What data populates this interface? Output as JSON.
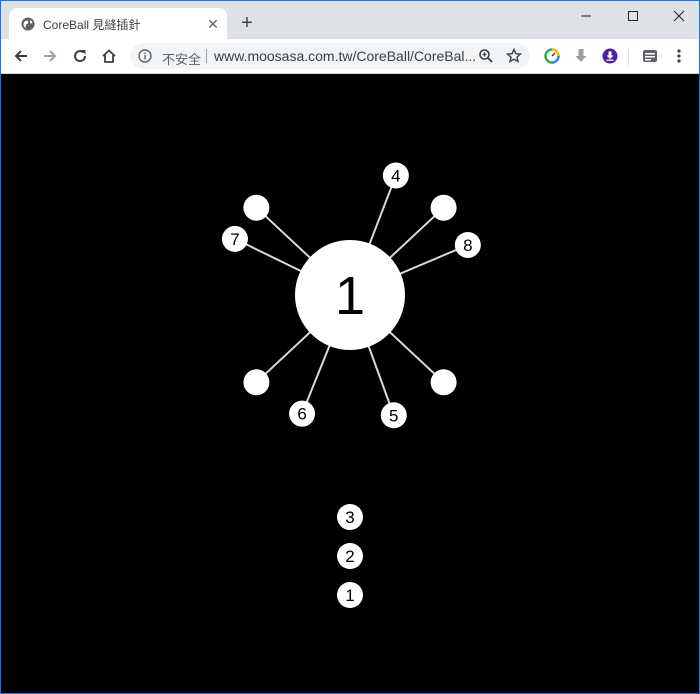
{
  "tab": {
    "title": "CoreBall 見縫插針",
    "close_glyph": "✕",
    "icon": "globe-icon"
  },
  "new_tab_glyph": "+",
  "window_controls": {
    "minimize": "minimize-icon",
    "maximize": "maximize-icon",
    "close": "close-icon"
  },
  "toolbar": {
    "security_label": "不安全",
    "url": "www.moosasa.com.tw/CoreBall/CoreBal...",
    "icons": [
      "back-icon",
      "forward-icon",
      "reload-icon",
      "home-icon",
      "info-icon",
      "zoom-icon",
      "bookmark-star-icon",
      "extension-icon",
      "download-gray-icon",
      "download-purple-icon",
      "extension-icon",
      "menu-icon"
    ]
  },
  "colors": {
    "game_background": "#000000",
    "ball": "#ffffff",
    "needle": "#d9d9d9",
    "number_text": "#000000",
    "accent_purple": "#4a1fa3",
    "accent_blue": "#1a73e8"
  },
  "game": {
    "level": "1",
    "pins": [
      {
        "angle_deg": -69,
        "label": "4"
      },
      {
        "angle_deg": -43,
        "label": ""
      },
      {
        "angle_deg": -23,
        "label": "8"
      },
      {
        "angle_deg": 43,
        "label": ""
      },
      {
        "angle_deg": 70,
        "label": "5"
      },
      {
        "angle_deg": 112,
        "label": "6"
      },
      {
        "angle_deg": 137,
        "label": ""
      },
      {
        "angle_deg": 206,
        "label": "7"
      },
      {
        "angle_deg": 223,
        "label": ""
      }
    ],
    "queue": [
      "3",
      "2",
      "1"
    ]
  }
}
